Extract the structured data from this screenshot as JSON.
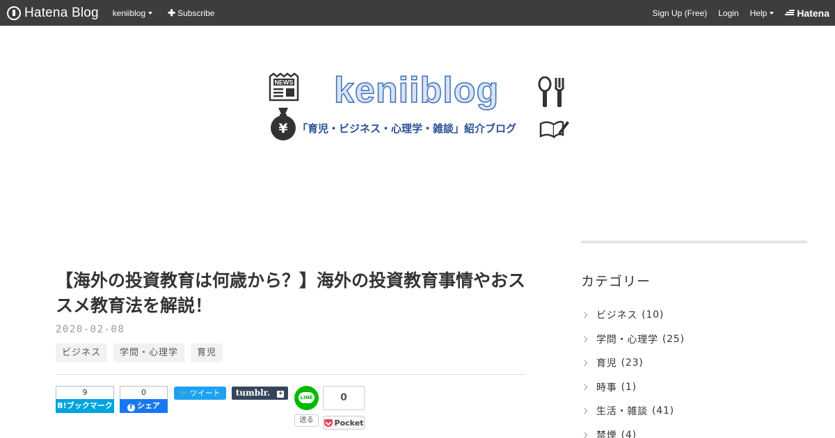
{
  "topbar": {
    "brand": "Hatena Blog",
    "blog_menu": "keniiblog",
    "subscribe": "Subscribe",
    "signup": "Sign Up (Free)",
    "login": "Login",
    "help": "Help",
    "hatena_logo": "Hatena",
    "bar_color": "#3d3d3d"
  },
  "banner": {
    "title": "keniiblog",
    "subtitle": "「育児・ビジネス・心理学・雑談」紹介ブログ",
    "news_label": "NEWS",
    "money_symbol": "¥"
  },
  "article": {
    "title": "【海外の投資教育は何歳から？】海外の投資教育事情やおススメ教育法を解説！",
    "date": "2020-02-08",
    "tags": [
      "ビジネス",
      "学問・心理学",
      "育児"
    ]
  },
  "share": {
    "hatebu_count": "9",
    "hatebu_label": "B!ブックマーク",
    "facebook_count": "0",
    "facebook_label": "シェア",
    "tweet_label": "ツイート",
    "tumblr_label": "tumblr.",
    "line_label": "LINE",
    "line_send": "送る",
    "pocket_count": "0",
    "pocket_label": "Pocket"
  },
  "sidebar": {
    "heading": "カテゴリー",
    "categories": [
      {
        "name": "ビジネス",
        "count": "(10)"
      },
      {
        "name": "学問・心理学",
        "count": "(25)"
      },
      {
        "name": "育児",
        "count": "(23)"
      },
      {
        "name": "時事",
        "count": "(1)"
      },
      {
        "name": "生活・雑談",
        "count": "(41)"
      },
      {
        "name": "禁煙",
        "count": "(4)"
      }
    ]
  }
}
